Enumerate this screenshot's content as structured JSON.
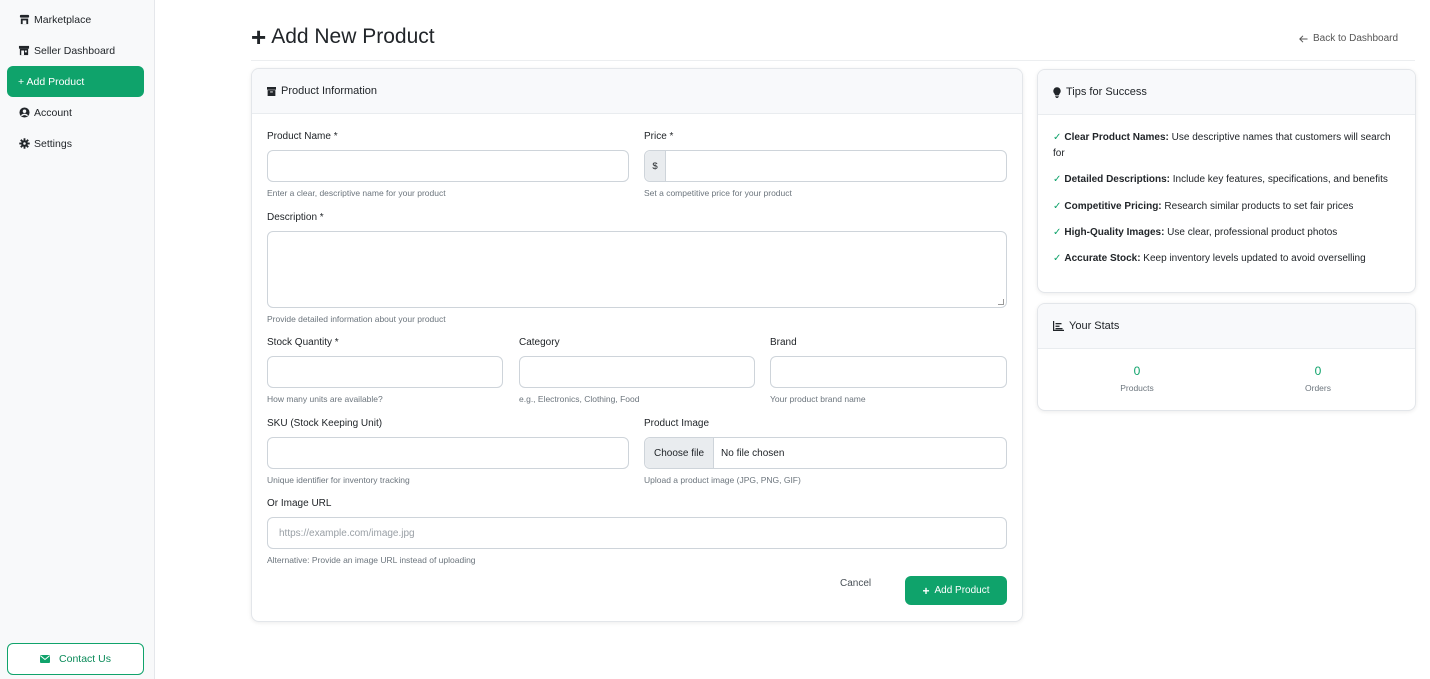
{
  "sidebar": {
    "items": [
      {
        "label": "Marketplace",
        "icon": "store-icon"
      },
      {
        "label": "Seller Dashboard",
        "icon": "shop-icon"
      },
      {
        "label": "+ Add Product",
        "icon": ""
      },
      {
        "label": "Account",
        "icon": "user-circle-icon"
      },
      {
        "label": "Settings",
        "icon": "gear-icon"
      }
    ],
    "contact_label": "Contact Us"
  },
  "header": {
    "title": "Add New Product",
    "back_label": "Back to Dashboard"
  },
  "form": {
    "card_title": "Product Information",
    "product_name": {
      "label": "Product Name *",
      "value": "",
      "hint": "Enter a clear, descriptive name for your product"
    },
    "price": {
      "label": "Price *",
      "prefix": "$",
      "value": "",
      "hint": "Set a competitive price for your product"
    },
    "description": {
      "label": "Description *",
      "value": "",
      "hint": "Provide detailed information about your product"
    },
    "stock": {
      "label": "Stock Quantity *",
      "value": "",
      "hint": "How many units are available?"
    },
    "category": {
      "label": "Category",
      "value": "",
      "hint": "e.g., Electronics, Clothing, Food"
    },
    "brand": {
      "label": "Brand",
      "value": "",
      "hint": "Your product brand name"
    },
    "sku": {
      "label": "SKU (Stock Keeping Unit)",
      "value": "",
      "hint": "Unique identifier for inventory tracking"
    },
    "image": {
      "label": "Product Image",
      "button": "Choose file",
      "status": "No file chosen",
      "hint": "Upload a product image (JPG, PNG, GIF)"
    },
    "image_url": {
      "label": "Or Image URL",
      "placeholder": "https://example.com/image.jpg",
      "hint": "Alternative: Provide an image URL instead of uploading"
    },
    "cancel_label": "Cancel",
    "submit_label": "Add Product"
  },
  "tips": {
    "title": "Tips for Success",
    "items": [
      {
        "bold": "Clear Product Names:",
        "text": " Use descriptive names that customers will search for"
      },
      {
        "bold": "Detailed Descriptions:",
        "text": " Include key features, specifications, and benefits"
      },
      {
        "bold": "Competitive Pricing:",
        "text": " Research similar products to set fair prices"
      },
      {
        "bold": "High-Quality Images:",
        "text": " Use clear, professional product photos"
      },
      {
        "bold": "Accurate Stock:",
        "text": " Keep inventory levels updated to avoid overselling"
      }
    ]
  },
  "stats": {
    "title": "Your Stats",
    "products": {
      "value": "0",
      "label": "Products"
    },
    "orders": {
      "value": "0",
      "label": "Orders"
    }
  },
  "colors": {
    "accent": "#0fa36b",
    "sidebar_bg": "#f8f9fa"
  }
}
